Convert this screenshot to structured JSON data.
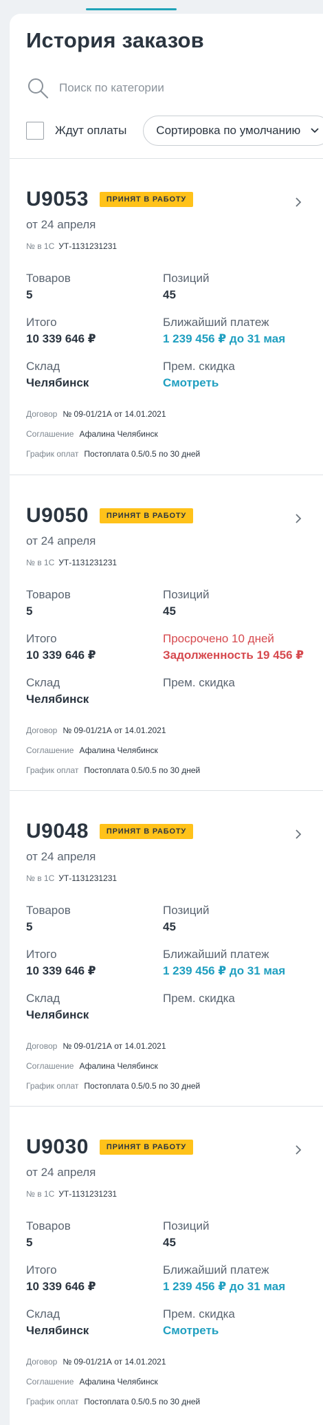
{
  "header": {
    "title": "История заказов",
    "search_placeholder": "Поиск по категории",
    "filter_label": "Ждут оплаты",
    "sort_label": "Сортировка по умолчанию"
  },
  "labels": {
    "no_1c": "№ в 1С",
    "items": "Товаров",
    "positions": "Позиций",
    "total": "Итого",
    "nearest_payment": "Ближайший платеж",
    "warehouse": "Склад",
    "prem_discount": "Прем. скидка",
    "contract": "Договор",
    "agreement": "Соглашение",
    "payment_schedule": "График оплат"
  },
  "orders": [
    {
      "id": "U9053",
      "status": "ПРИНЯТ В РАБОТУ",
      "date": "от 24 апреля",
      "no_1c": "УТ-1131231231",
      "items": "5",
      "positions": "45",
      "total": "10 339 646 ₽",
      "payment_label": "Ближайший платеж",
      "payment_value": "1 239 456 ₽ до 31 мая",
      "warehouse": "Челябинск",
      "discount_value": "Смотреть",
      "contract": "№ 09-01/21А от 14.01.2021",
      "agreement": "Афалина Челябинск",
      "schedule": "Постоплата 0.5/0.5 по 30 дней"
    },
    {
      "id": "U9050",
      "status": "ПРИНЯТ В РАБОТУ",
      "date": "от 24 апреля",
      "no_1c": "УТ-1131231231",
      "items": "5",
      "positions": "45",
      "total": "10 339 646 ₽",
      "payment_label": "Просрочено 10 дней",
      "payment_value": "Задолженность 19 456 ₽",
      "warehouse": "Челябинск",
      "discount_value": "",
      "contract": "№ 09-01/21А от 14.01.2021",
      "agreement": "Афалина Челябинск",
      "schedule": "Постоплата 0.5/0.5 по 30 дней"
    },
    {
      "id": "U9048",
      "status": "ПРИНЯТ В РАБОТУ",
      "date": "от 24 апреля",
      "no_1c": "УТ-1131231231",
      "items": "5",
      "positions": "45",
      "total": "10 339 646 ₽",
      "payment_label": "Ближайший платеж",
      "payment_value": "1 239 456 ₽ до 31 мая",
      "warehouse": "Челябинск",
      "discount_value": "",
      "contract": "№ 09-01/21А от 14.01.2021",
      "agreement": "Афалина Челябинск",
      "schedule": "Постоплата 0.5/0.5 по 30 дней"
    },
    {
      "id": "U9030",
      "status": "ПРИНЯТ В РАБОТУ",
      "date": "от 24 апреля",
      "no_1c": "УТ-1131231231",
      "items": "5",
      "positions": "45",
      "total": "10 339 646 ₽",
      "payment_label": "Ближайший платеж",
      "payment_value": "1 239 456 ₽ до 31 мая",
      "warehouse": "Челябинск",
      "discount_value": "Смотреть",
      "contract": "№ 09-01/21А от 14.01.2021",
      "agreement": "Афалина Челябинск",
      "schedule": "Постоплата 0.5/0.5 по 30 дней"
    }
  ],
  "colors": {
    "accent": "#1fa3b8",
    "link": "#1f9fc0",
    "badge": "#ffc21a",
    "danger": "#d6494e",
    "text": "#2b3540"
  }
}
